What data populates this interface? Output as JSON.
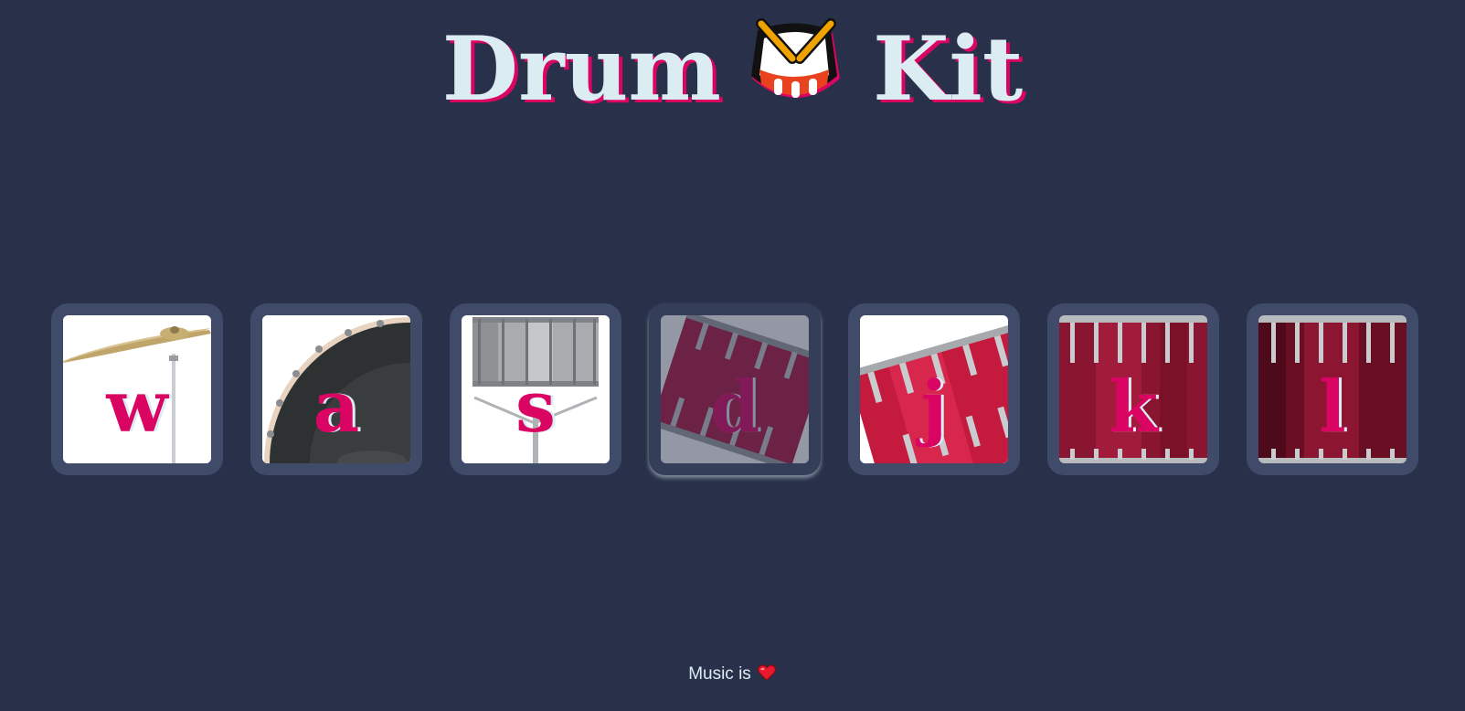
{
  "header": {
    "title_left": "Drum",
    "title_right": "Kit",
    "title_icon": "drum-emoji-icon"
  },
  "drums": [
    {
      "key": "w",
      "instrument_icon": "crash-cymbal-icon"
    },
    {
      "key": "a",
      "instrument_icon": "kick-drum-icon"
    },
    {
      "key": "s",
      "instrument_icon": "snare-drum-icon"
    },
    {
      "key": "d",
      "instrument_icon": "tom-1-icon",
      "state": "pressed"
    },
    {
      "key": "j",
      "instrument_icon": "tom-2-icon"
    },
    {
      "key": "k",
      "instrument_icon": "tom-3-icon"
    },
    {
      "key": "l",
      "instrument_icon": "tom-4-icon"
    }
  ],
  "footer": {
    "text": "Music is",
    "icon": "heart-icon"
  },
  "colors": {
    "background": "#283149",
    "tile": "#404B69",
    "accent": "#DA0463",
    "light": "#DBEDF3"
  }
}
